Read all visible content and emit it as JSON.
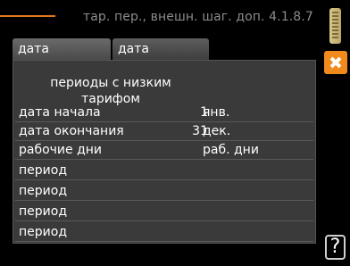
{
  "header": {
    "title": "тар. пер., внешн. шаг. доп. 4.1.8.7"
  },
  "tabs": [
    {
      "label": "дата"
    },
    {
      "label": "дата"
    }
  ],
  "section_heading": "периоды с низким тарифом",
  "rows": [
    {
      "label": "дата начала",
      "number": "1",
      "unit": "янв."
    },
    {
      "label": "дата окончания",
      "number": "31",
      "unit": "дек."
    },
    {
      "label": "рабочие дни",
      "number": "",
      "unit": "раб. дни"
    },
    {
      "label": "период",
      "number": "",
      "unit": ""
    },
    {
      "label": "период",
      "number": "",
      "unit": ""
    },
    {
      "label": "период",
      "number": "",
      "unit": ""
    },
    {
      "label": "период",
      "number": "",
      "unit": ""
    }
  ],
  "help": {
    "glyph": "?"
  },
  "colors": {
    "accent": "#e0781c",
    "panel": "#3a3a3a",
    "side_icon": "#f08a1c"
  },
  "icons": [
    "thermometer-icon",
    "tools-icon",
    "help-icon"
  ]
}
